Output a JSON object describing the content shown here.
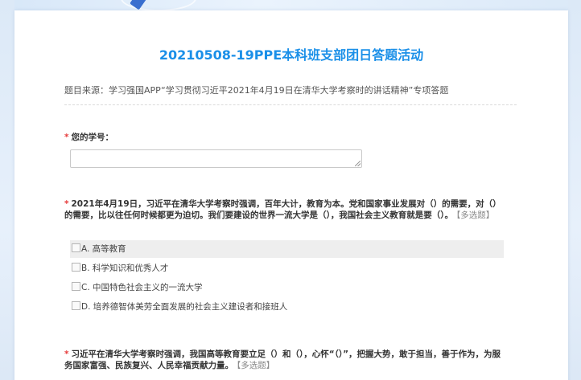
{
  "survey": {
    "title": "20210508-19PPE本科班支部团日答题活动",
    "description": "题目来源：学习强国APP“学习贯彻习近平2021年4月19日在清华大学考察时的讲话精神”专项答题"
  },
  "questions": [
    {
      "required_mark": "*",
      "text": "您的学号：",
      "answer_value": ""
    },
    {
      "required_mark": "*",
      "text": "2021年4月19日，习近平在清华大学考察时强调，百年大计，教育为本。党和国家事业发展对（）的需要，对（）的需要，比以往任何时候都更为迫切。我们要建设的世界一流大学是（），我国社会主义教育就是要（）。",
      "tag": "【多选题】",
      "options": [
        "A. 高等教育",
        "B. 科学知识和优秀人才",
        "C. 中国特色社会主义的一流大学",
        "D. 培养德智体美劳全面发展的社会主义建设者和接班人"
      ]
    },
    {
      "required_mark": "*",
      "text": "习近平在清华大学考察时强调，我国高等教育要立足（）和（），心怀“（）”，把握大势，敢于担当，善于作为，为服务国家富强、民族复兴、人民幸福贡献力量。",
      "tag": "【多选题】"
    }
  ],
  "colors": {
    "accent": "#1a8fe8",
    "required": "#e63b3b",
    "background": "#dde9f7",
    "highlight_row": "#eeeeee"
  }
}
